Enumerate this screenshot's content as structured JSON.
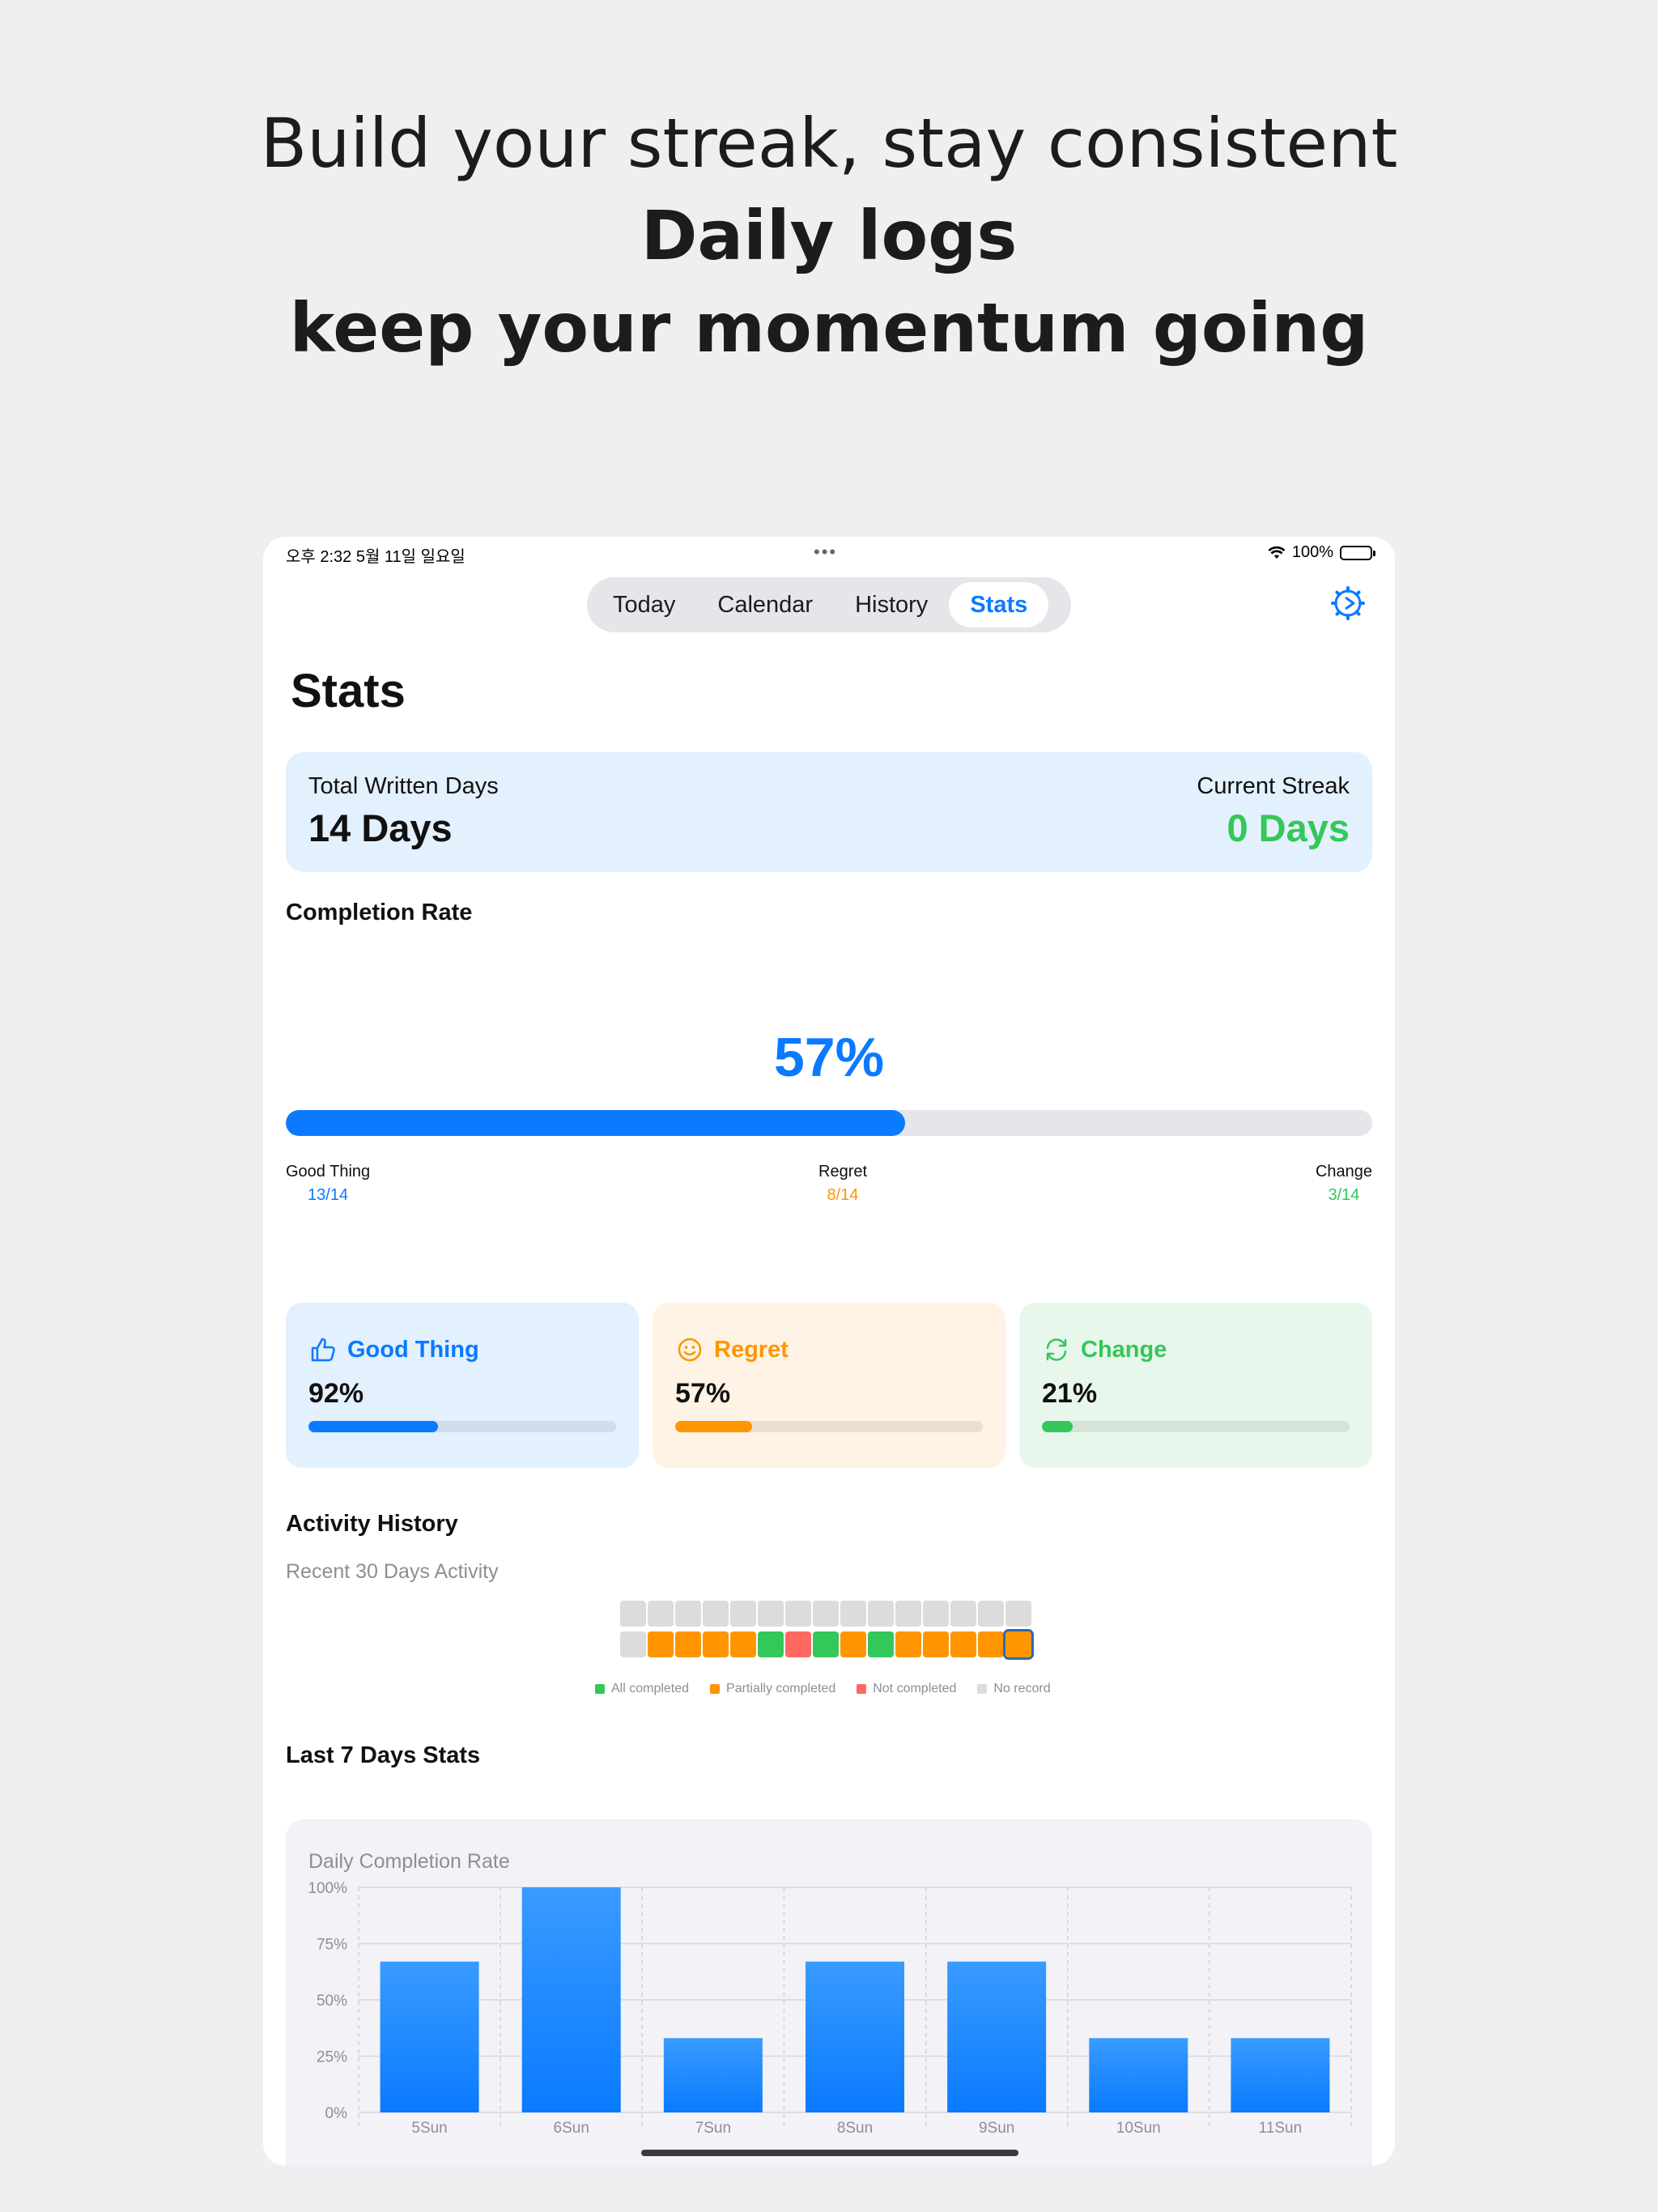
{
  "headline": {
    "line1": "Build your streak, stay consistent",
    "line2": "Daily logs",
    "line3": "keep your momentum going"
  },
  "status_bar": {
    "time": "오후 2:32   5월 11일 일요일",
    "battery": "100%"
  },
  "tabs": [
    {
      "label": "Today",
      "active": false
    },
    {
      "label": "Calendar",
      "active": false
    },
    {
      "label": "History",
      "active": false
    },
    {
      "label": "Stats",
      "active": true
    }
  ],
  "page_title": "Stats",
  "summary": {
    "total_label": "Total Written Days",
    "total_value": "14 Days",
    "streak_label": "Current Streak",
    "streak_value": "0 Days"
  },
  "completion": {
    "title": "Completion Rate",
    "percent_text": "57%",
    "percent": 57,
    "categories": [
      {
        "name": "Good Thing",
        "value": "13/14",
        "color": "#0a7aff"
      },
      {
        "name": "Regret",
        "value": "8/14",
        "color": "#ff9500"
      },
      {
        "name": "Change",
        "value": "3/14",
        "color": "#34c759"
      }
    ]
  },
  "cards": [
    {
      "name": "Good Thing",
      "percent_text": "92%",
      "fill": 0.42,
      "color": "#0a7aff",
      "bg": "#e3f0fd",
      "icon": "thumbs-up-icon"
    },
    {
      "name": "Regret",
      "percent_text": "57%",
      "fill": 0.25,
      "color": "#ff9500",
      "bg": "#fef3e4",
      "icon": "smiley-icon"
    },
    {
      "name": "Change",
      "percent_text": "21%",
      "fill": 0.1,
      "color": "#34c759",
      "bg": "#e8f7ec",
      "icon": "refresh-icon"
    }
  ],
  "activity": {
    "title": "Activity History",
    "subtitle": "Recent 30 Days Activity",
    "colors": {
      "all": "#34c759",
      "partial": "#ff9500",
      "none": "#ff6961",
      "empty": "#dcdcdc"
    },
    "row1": [
      "empty",
      "empty",
      "empty",
      "empty",
      "empty",
      "empty",
      "empty",
      "empty",
      "empty",
      "empty",
      "empty",
      "empty",
      "empty",
      "empty",
      "empty"
    ],
    "row2": [
      "empty",
      "partial",
      "partial",
      "partial",
      "partial",
      "all",
      "none",
      "all",
      "partial",
      "all",
      "partial",
      "partial",
      "partial",
      "partial",
      "partial"
    ],
    "today_index": 14,
    "legend": [
      {
        "label": "All completed",
        "color": "#34c759"
      },
      {
        "label": "Partially completed",
        "color": "#ff9500"
      },
      {
        "label": "Not completed",
        "color": "#ff6961"
      },
      {
        "label": "No record",
        "color": "#dcdcdc"
      }
    ]
  },
  "last7": {
    "title": "Last 7 Days Stats"
  },
  "chart_data": {
    "type": "bar",
    "title": "Daily Completion Rate",
    "categories": [
      "5Sun",
      "6Sun",
      "7Sun",
      "8Sun",
      "9Sun",
      "10Sun",
      "11Sun"
    ],
    "values": [
      67,
      100,
      33,
      67,
      67,
      33,
      33
    ],
    "ylim": [
      0,
      100
    ],
    "yticks": [
      "0%",
      "25%",
      "50%",
      "75%",
      "100%"
    ],
    "bar_color": "#0a7aff",
    "grid": true
  }
}
